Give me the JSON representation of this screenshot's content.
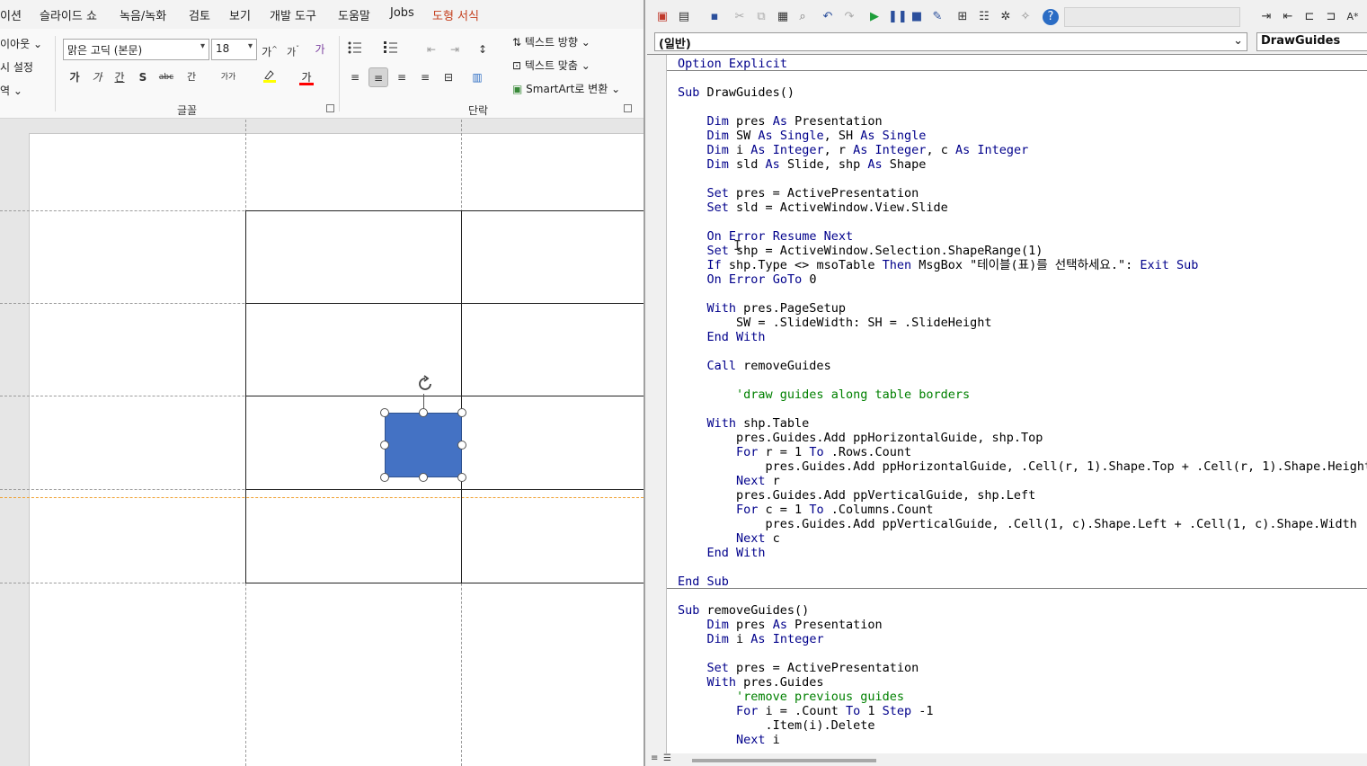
{
  "ppt": {
    "tabs": [
      {
        "label": "이션"
      },
      {
        "label": "슬라이드 쇼"
      },
      {
        "label": "녹음/녹화"
      },
      {
        "label": "검토"
      },
      {
        "label": "보기"
      },
      {
        "label": "개발 도구"
      },
      {
        "label": "도움말"
      },
      {
        "label": "Jobs"
      },
      {
        "label": "도형 서식"
      }
    ],
    "ribbon": {
      "left_items": [
        "이아웃",
        "시 설정",
        "역"
      ],
      "font_name": "맑은 고딕 (본문)",
      "font_size": "18",
      "font_group_label": "글꼴",
      "paragraph_group_label": "단락",
      "text_direction": "텍스트 방향",
      "align_text": "텍스트 맞춤",
      "smartart": "SmartArt로 변환",
      "font_buttons": [
        "가",
        "가",
        "간",
        "S",
        "abc",
        "간",
        "가가"
      ],
      "grow_font": "가",
      "shrink_font": "가",
      "clear_format": "가",
      "font_color_glyph": "가"
    },
    "colors": {
      "accent": "#c43e1c",
      "shape_fill": "#4472c4",
      "highlight": "#ffff00",
      "font_color": "#ff0000",
      "guide_orange": "#f0a030"
    }
  },
  "vbe": {
    "object_combo": "(일반)",
    "proc_combo": "DrawGuides",
    "code_lines": [
      "Option Explicit",
      "",
      "Sub DrawGuides()",
      "",
      "    Dim pres As Presentation",
      "    Dim SW As Single, SH As Single",
      "    Dim i As Integer, r As Integer, c As Integer",
      "    Dim sld As Slide, shp As Shape",
      "",
      "    Set pres = ActivePresentation",
      "    Set sld = ActiveWindow.View.Slide",
      "",
      "    On Error Resume Next",
      "    Set shp = ActiveWindow.Selection.ShapeRange(1)",
      "    If shp.Type <> msoTable Then MsgBox \"테이블(표)를 선택하세요.\": Exit Sub",
      "    On Error GoTo 0",
      "",
      "    With pres.PageSetup",
      "        SW = .SlideWidth: SH = .SlideHeight",
      "    End With",
      "",
      "    Call removeGuides",
      "",
      "        'draw guides along table borders",
      "",
      "    With shp.Table",
      "        pres.Guides.Add ppHorizontalGuide, shp.Top",
      "        For r = 1 To .Rows.Count",
      "            pres.Guides.Add ppHorizontalGuide, .Cell(r, 1).Shape.Top + .Cell(r, 1).Shape.Height",
      "        Next r",
      "        pres.Guides.Add ppVerticalGuide, shp.Left",
      "        For c = 1 To .Columns.Count",
      "            pres.Guides.Add ppVerticalGuide, .Cell(1, c).Shape.Left + .Cell(1, c).Shape.Width",
      "        Next c",
      "    End With",
      "",
      "End Sub",
      "",
      "Sub removeGuides()",
      "    Dim pres As Presentation",
      "    Dim i As Integer",
      "",
      "    Set pres = ActivePresentation",
      "    With pres.Guides",
      "        'remove previous guides",
      "        For i = .Count To 1 Step -1",
      "            .Item(i).Delete",
      "        Next i"
    ]
  }
}
